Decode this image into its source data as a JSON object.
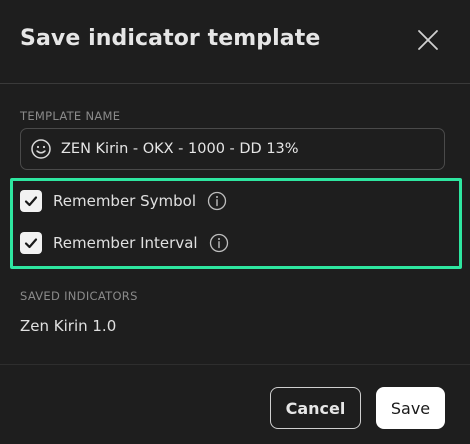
{
  "dialog": {
    "title": "Save indicator template"
  },
  "template_name": {
    "label": "TEMPLATE NAME",
    "value": "ZEN Kirin - OKX - 1000 - DD 13%",
    "icon": "smiley-icon"
  },
  "options": [
    {
      "label": "Remember Symbol",
      "checked": true,
      "info_icon": "info-icon"
    },
    {
      "label": "Remember Interval",
      "checked": true,
      "info_icon": "info-icon"
    }
  ],
  "highlight_color": "#2ee6a0",
  "saved_indicators": {
    "label": "SAVED INDICATORS",
    "items": [
      "Zen Kirin 1.0"
    ]
  },
  "buttons": {
    "cancel": "Cancel",
    "save": "Save"
  }
}
